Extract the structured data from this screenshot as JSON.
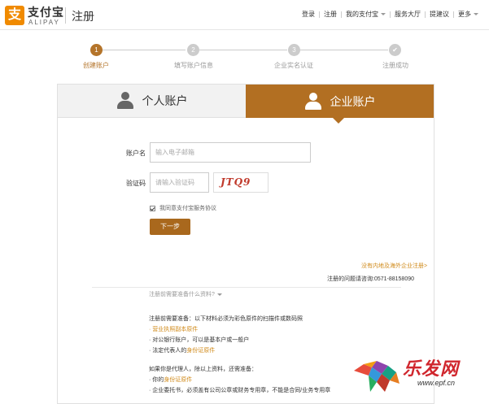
{
  "header": {
    "logo_mark": "支",
    "logo_cn": "支付宝",
    "logo_en": "ALIPAY",
    "page_title": "注册",
    "nav": {
      "login": "登录",
      "register": "注册",
      "my_alipay": "我的支付宝",
      "service_hall": "服务大厅",
      "suggestion": "提建议",
      "more": "更多"
    }
  },
  "steps": [
    {
      "number": "1",
      "label": "创建账户",
      "active": true
    },
    {
      "number": "2",
      "label": "填写账户信息",
      "active": false
    },
    {
      "number": "3",
      "label": "企业实名认证",
      "active": false
    },
    {
      "number": "✔",
      "label": "注册成功",
      "active": false
    }
  ],
  "tabs": {
    "personal": "个人账户",
    "company": "企业账户"
  },
  "form": {
    "account_label": "账户名",
    "account_placeholder": "输入电子邮箱",
    "captcha_label": "验证码",
    "captcha_placeholder": "请输入验证码",
    "captcha_text": "JTQ9",
    "agree_text": "我同意支付宝服务协议",
    "next_button": "下一步"
  },
  "overseas_link": "没有内地及海外企业注册>",
  "help_line": "注册的问题请咨询:0571-88158090",
  "materials_toggle": "注册前需要准备什么资料?",
  "info": {
    "line1": "注册前需要准备：以下材料必须为彩色原件的扫描件或数码照",
    "line2": "· 营业执照副本原件",
    "line3": "· 对公银行账户，可以是基本户或一般户",
    "line4_prefix": "· 法定代表人的",
    "line4_link": "身份证原件",
    "line5": "如果你是代理人，除以上资料，还需准备：",
    "line6_prefix": "· 你的",
    "line6_link": "身份证原件",
    "line7": "· 企业委托书，必须盖有公司公章或财务专用章，不能是合同/业务专用章"
  },
  "watermark": {
    "cn": "乐发网",
    "url": "www.epf.cn"
  },
  "colors": {
    "brand_orange": "#f08a00",
    "accent_brown": "#b26f22",
    "link_orange": "#d08a1a",
    "watermark_red": "#d0262d"
  }
}
